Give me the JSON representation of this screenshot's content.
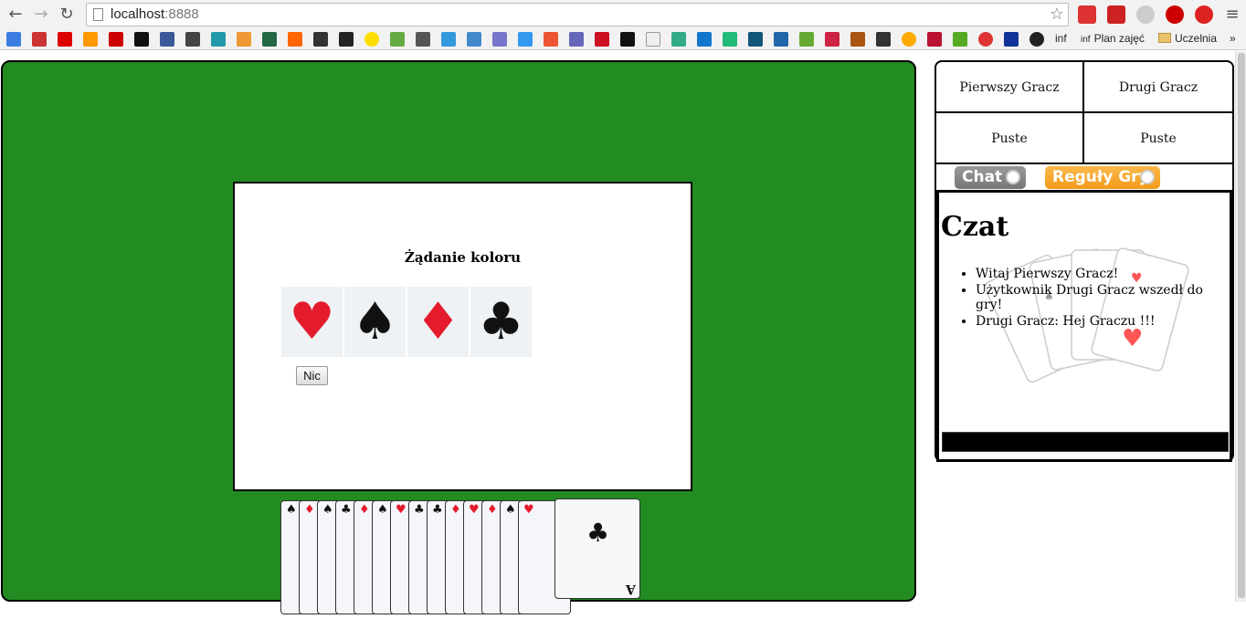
{
  "browser": {
    "url_host": "localhost",
    "url_port": ":8888",
    "bookmarks": {
      "plan": "Plan zajęć",
      "folder": "Uczelnia",
      "inf": "inf",
      "more": "»"
    }
  },
  "players": {
    "first": "Pierwszy Gracz",
    "second": "Drugi Gracz",
    "first_slot": "Puste",
    "second_slot": "Puste"
  },
  "tabs": {
    "chat": "Chat",
    "rules": "Reguły Gry"
  },
  "modal": {
    "title": "Żądanie koloru",
    "suits": [
      "♥",
      "♠",
      "♦",
      "♣"
    ],
    "none_button": "Nic"
  },
  "chat": {
    "title": "Czat",
    "messages": [
      "Witaj Pierwszy Gracz!",
      "Użytkownik Drugi Gracz wszedł do gry!",
      "Drugi Gracz: Hej Graczu !!!"
    ]
  },
  "hand": {
    "pips": [
      "♠",
      "♦",
      "♠",
      "♣",
      "♦",
      "♠",
      "♥",
      "♣",
      "♣",
      "♦",
      "♥",
      "♦",
      "♠",
      "♥"
    ],
    "top_card": {
      "suit": "♣",
      "rank": "A"
    }
  },
  "colors": {
    "table": "#228b22",
    "red_suit": "#e41b2c",
    "chat_tab": "#888888",
    "rules_tab": "#f5a623"
  }
}
